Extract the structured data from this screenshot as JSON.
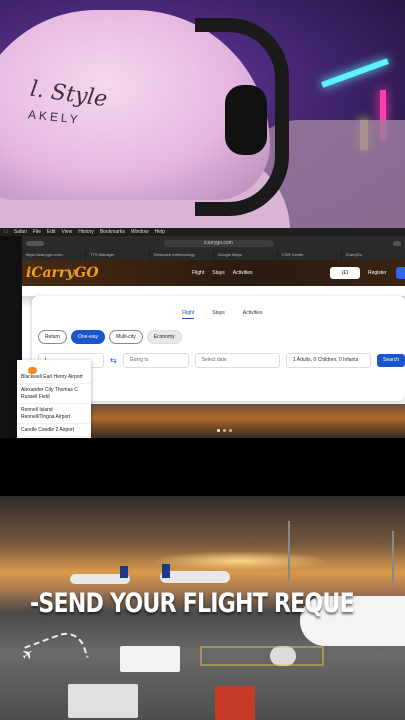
{
  "webcam": {
    "cap_line1": "l. Style",
    "cap_line2": "AKELY"
  },
  "mac_menubar": {
    "items": [
      "Safari",
      "File",
      "Edit",
      "View",
      "History",
      "Bookmarks",
      "Window",
      "Help"
    ]
  },
  "browser": {
    "url": "icarrygo.com",
    "tabs": [
      "https://icarrygo.com/...",
      "TTS Manager",
      "Research methodology",
      "Google Maps",
      "CSR Center",
      "iCarryGo"
    ]
  },
  "site": {
    "logo": "iCarryGO",
    "nav": [
      "Flight",
      "Stays",
      "Activities"
    ],
    "currency": "(£)",
    "register_label": "Register",
    "service_tabs": [
      "Flight",
      "Stays",
      "Activities"
    ],
    "trip_types": [
      "Return",
      "One-way",
      "Multi-city"
    ],
    "selected_trip": "One-way",
    "cabin": "Economy",
    "from_value": "L",
    "to_placeholder": "Going to",
    "date_placeholder": "Select date",
    "travellers": "1 Adults, 0 Children, 0 Infants",
    "search_label": "Search",
    "suggestions": [
      "Blackwell Earl Henry Airport",
      "Alexander City Thomas C Russell Field",
      "Rennell Island Rennell/Tingoa Airport",
      "Candle Candle 2 Airport"
    ]
  },
  "promo": {
    "headline": "-SEND YOUR FLIGHT REQUE"
  },
  "colors": {
    "accent": "#1a55cc",
    "logo": "#f0a01e"
  }
}
